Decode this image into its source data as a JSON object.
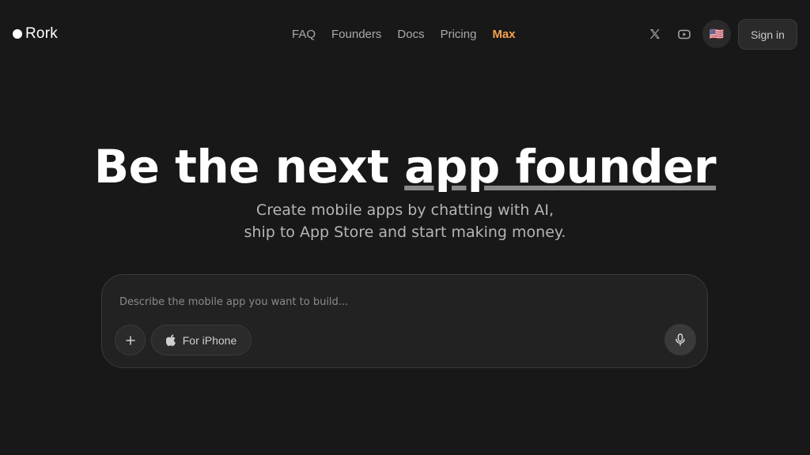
{
  "brand": {
    "name": "Rork"
  },
  "nav": [
    {
      "label": "FAQ"
    },
    {
      "label": "Founders"
    },
    {
      "label": "Docs"
    },
    {
      "label": "Pricing"
    },
    {
      "label": "Max",
      "highlight_color": "#f5a24a"
    }
  ],
  "header_actions": {
    "x_icon": "x-logo-icon",
    "youtube_icon": "youtube-icon",
    "flag": "🇺🇸",
    "signin_label": "Sign in"
  },
  "hero": {
    "title_lead": "Be the next ",
    "title_highlight": "app founder",
    "subtitle_line1": "Create mobile apps by chatting with AI,",
    "subtitle_line2": "ship to App Store and start making money."
  },
  "prompt": {
    "placeholder": "Describe the mobile app you want to build...",
    "value": "",
    "add_icon": "plus-icon",
    "platform_label": "For iPhone",
    "platform_icon": "apple-icon",
    "mic_icon": "microphone-icon"
  },
  "colors": {
    "background": "#181818",
    "accent": "#f5a24a",
    "panel": "#222222"
  }
}
